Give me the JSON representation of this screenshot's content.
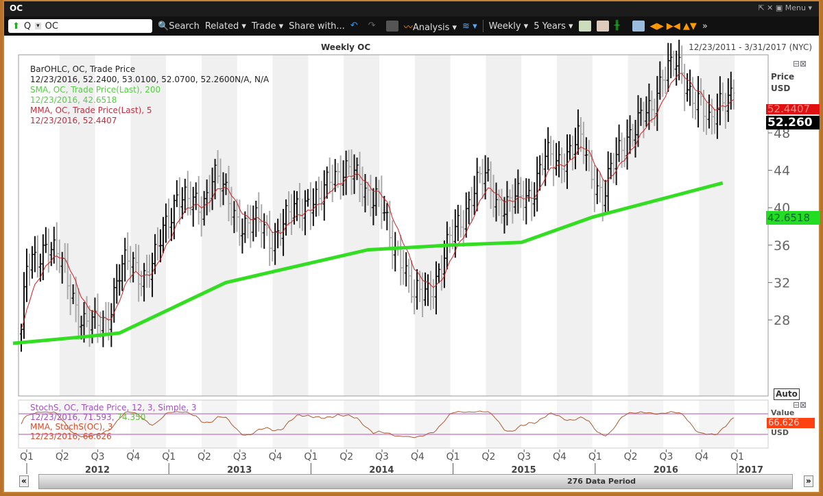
{
  "window": {
    "title": "OC",
    "menu_label": "Menu"
  },
  "toolbar": {
    "symbol_type": "Q",
    "symbol": "OC",
    "search": "Search",
    "related": "Related",
    "trade": "Trade",
    "share": "Share with...",
    "analysis": "Analysis",
    "interval": "Weekly",
    "range": "5 Years"
  },
  "chart_header": {
    "title": "Weekly OC",
    "date_range": "12/23/2011 - 3/31/2017 (NYC)"
  },
  "legend": {
    "bar_title": "BarOHLC, OC, Trade Price",
    "bar_values": "12/23/2016, 52.2400, 53.0100, 52.0700, 52.2600N/A, N/A",
    "sma_title": "SMA, OC, Trade Price(Last),  200",
    "sma_values": "12/23/2016, 42.6518",
    "mma_title": "MMA, OC, Trade Price(Last),  5",
    "mma_values": "12/23/2016, 52.4407",
    "stoch_title": "StochS, OC, Trade Price,  12, 3, Simple, 3",
    "stoch_values_date": "12/23/2016, 71.593, ",
    "stoch_values_2": "74.350",
    "stoch_mma_title": "MMA, StochS(OC),  3",
    "stoch_mma_values": "12/23/2016, 66.626"
  },
  "axis": {
    "price_label": "Price",
    "currency": "USD",
    "auto": "Auto",
    "value_label": "Value"
  },
  "badges": {
    "mma": "52.4407",
    "last": "52.260",
    "sma": "42.6518",
    "stoch": "66.626"
  },
  "footer": {
    "data_period": "276 Data Period"
  },
  "colors": {
    "sma": "#33dd22",
    "mma": "#cc2222",
    "up_bar": "#111111",
    "down_bar": "#aaaaaa",
    "stoch": "#b05a30",
    "stoch_bands": "#cc88cc"
  },
  "chart_data": {
    "type": "ohlc-bar",
    "ylim": [
      23.5,
      60
    ],
    "yticks": [
      28,
      32,
      36,
      40,
      44,
      48
    ],
    "quarters": [
      "Q1",
      "Q2",
      "Q3",
      "Q4",
      "Q1",
      "Q2",
      "Q3",
      "Q4",
      "Q1",
      "Q2",
      "Q3",
      "Q4",
      "Q1",
      "Q2",
      "Q3",
      "Q4",
      "Q1",
      "Q2",
      "Q3",
      "Q4",
      "Q1"
    ],
    "years": [
      "2012",
      "2013",
      "2014",
      "2015",
      "2016",
      "2017"
    ],
    "monthly_close": {
      "months": [
        "2012-01",
        "2012-02",
        "2012-03",
        "2012-04",
        "2012-05",
        "2012-06",
        "2012-07",
        "2012-08",
        "2012-09",
        "2012-10",
        "2012-11",
        "2012-12",
        "2013-01",
        "2013-02",
        "2013-03",
        "2013-04",
        "2013-05",
        "2013-06",
        "2013-07",
        "2013-08",
        "2013-09",
        "2013-10",
        "2013-11",
        "2013-12",
        "2014-01",
        "2014-02",
        "2014-03",
        "2014-04",
        "2014-05",
        "2014-06",
        "2014-07",
        "2014-08",
        "2014-09",
        "2014-10",
        "2014-11",
        "2014-12",
        "2015-01",
        "2015-02",
        "2015-03",
        "2015-04",
        "2015-05",
        "2015-06",
        "2015-07",
        "2015-08",
        "2015-09",
        "2015-10",
        "2015-11",
        "2015-12",
        "2016-01",
        "2016-02",
        "2016-03",
        "2016-04",
        "2016-05",
        "2016-06",
        "2016-07",
        "2016-08",
        "2016-09",
        "2016-10",
        "2016-11",
        "2016-12"
      ],
      "values": [
        33,
        34,
        37,
        34,
        31,
        28,
        27,
        28,
        33,
        34,
        33,
        34,
        38,
        42,
        40,
        40,
        44,
        41,
        39,
        38,
        38,
        37,
        38,
        40,
        41,
        40,
        44,
        44,
        43,
        42,
        41,
        36,
        35,
        30,
        31,
        33,
        36,
        39,
        42,
        43,
        41,
        40,
        41,
        42,
        45,
        45,
        46,
        47,
        44,
        41,
        45,
        48,
        49,
        50,
        55,
        55,
        53,
        52,
        48,
        52.26
      ]
    },
    "sma200": {
      "dates": [
        "2011-12",
        "2012-06",
        "2012-09",
        "2013-06",
        "2014-06",
        "2015-01",
        "2015-07",
        "2016-01",
        "2016-12"
      ],
      "values": [
        25.5,
        26.2,
        26.6,
        32,
        35.5,
        36,
        36.3,
        39,
        42.65
      ]
    },
    "stoch_bands": [
      80,
      20
    ]
  }
}
